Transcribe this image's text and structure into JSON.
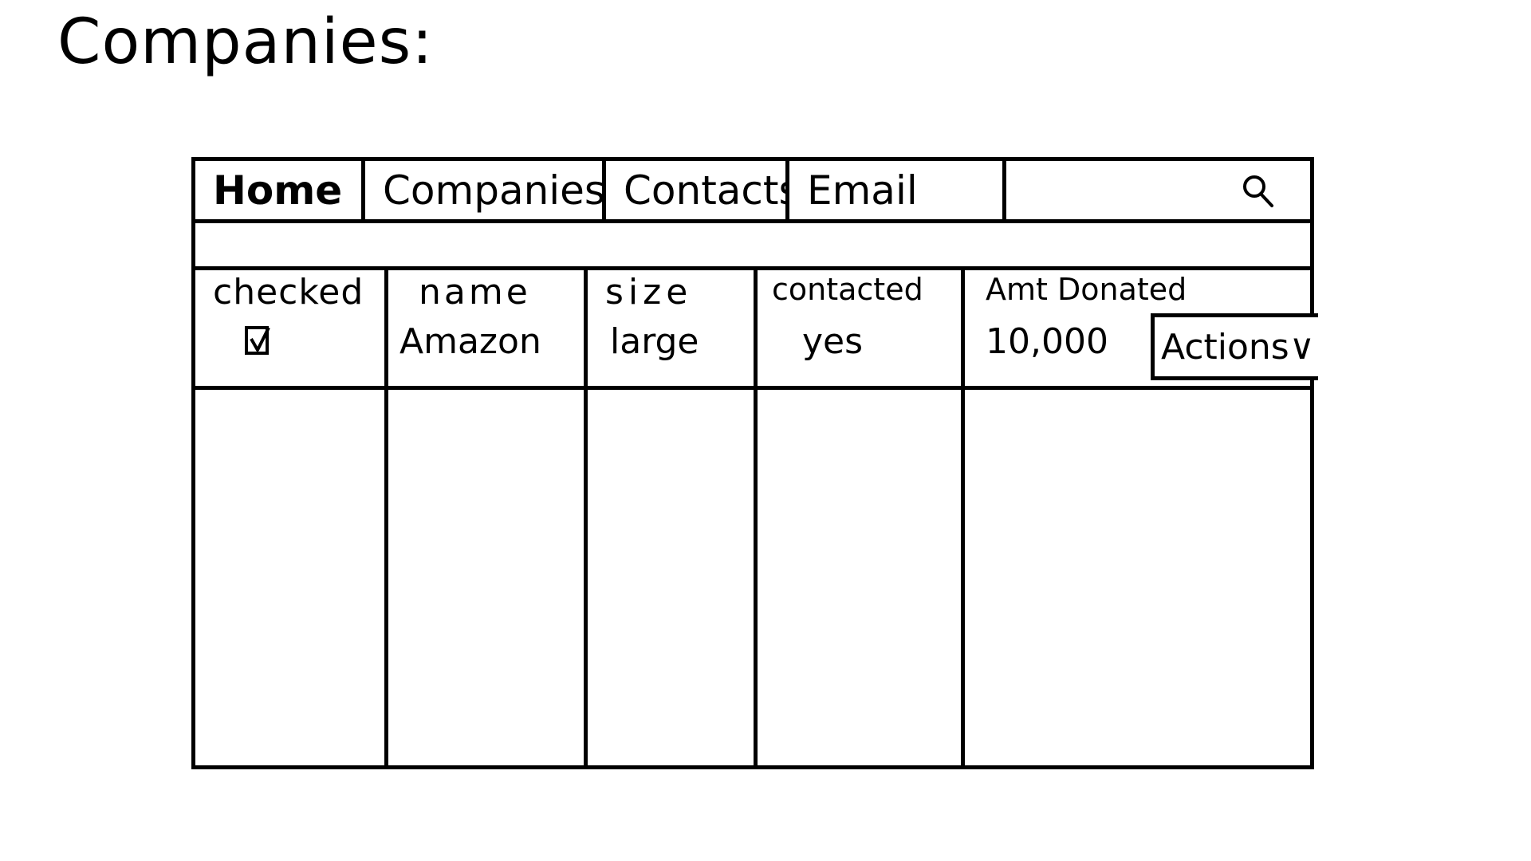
{
  "page": {
    "title": "Companies:"
  },
  "nav": {
    "items": [
      {
        "label": "Home"
      },
      {
        "label": "Companies"
      },
      {
        "label": "Contacts"
      },
      {
        "label": "Email"
      }
    ],
    "search": {
      "value": "",
      "icon": "search-icon"
    }
  },
  "table": {
    "columns": [
      "checked",
      "name",
      "size",
      "contacted",
      "Amt Donated"
    ],
    "rows": [
      {
        "checked": true,
        "name": "Amazon",
        "size": "large",
        "contacted": "yes",
        "amt_donated": "10,000",
        "actions_label": "Actions∨"
      }
    ]
  }
}
